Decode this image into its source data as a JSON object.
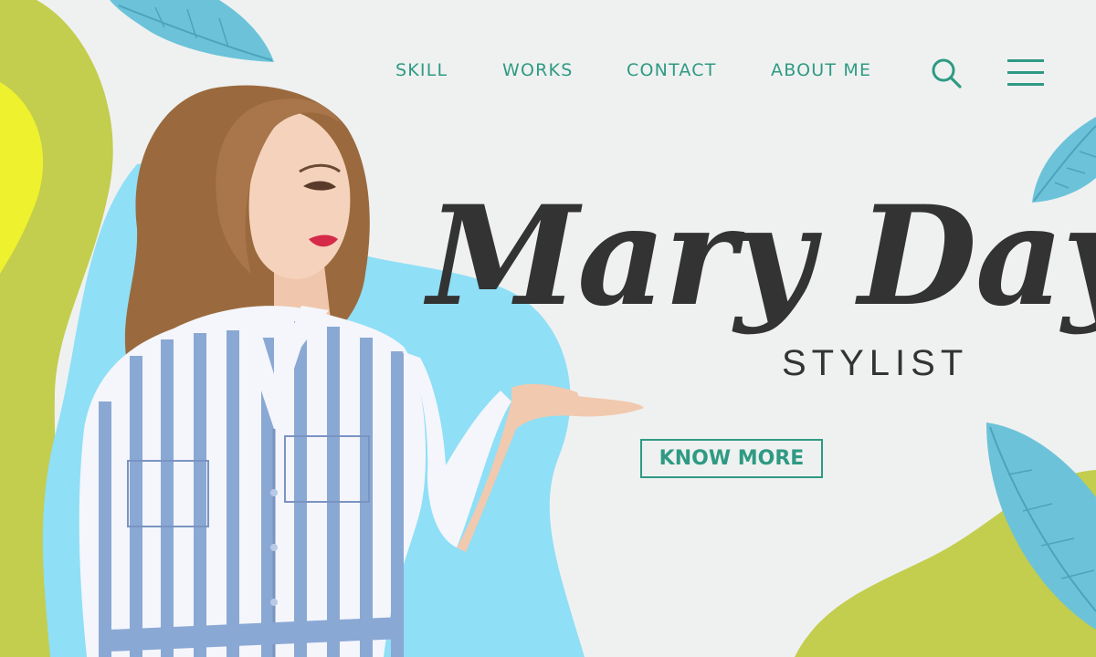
{
  "nav": {
    "items": [
      {
        "label": "SKILL"
      },
      {
        "label": "WORKS"
      },
      {
        "label": "CONTACT"
      },
      {
        "label": "ABOUT ME"
      }
    ]
  },
  "hero": {
    "title": "Mary Day",
    "subtitle": "STYLIST",
    "cta_label": "KNOW MORE"
  },
  "icons": {
    "search": "search-icon",
    "menu": "hamburger-menu-icon",
    "leaf": "leaf-icon"
  },
  "colors": {
    "accent": "#2f9a83",
    "background": "#eff1f1",
    "lime_blob": "#c3cd4e",
    "yellow_blob": "#eef12d",
    "blue_blob": "#8fdff6",
    "leaf": "#6cc3d9",
    "title_text": "#333333",
    "shirt_stripe": "#8aa8d4"
  }
}
